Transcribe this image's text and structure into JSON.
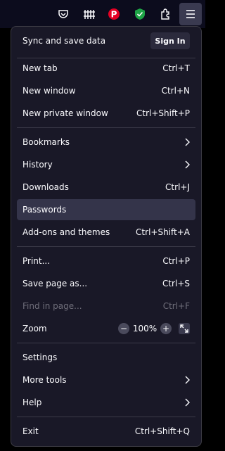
{
  "toolbar": {
    "icons": [
      "pocket-icon",
      "library-icon",
      "pinterest-icon",
      "shield-extension-icon",
      "extensions-icon",
      "menu-icon"
    ],
    "colors": {
      "pinterest": "#e60023",
      "shield": "#1ea446",
      "active_bg": "#3a3a50"
    }
  },
  "sync": {
    "title": "Sync and save data",
    "signin_label": "Sign In"
  },
  "group1": [
    {
      "label": "New tab",
      "shortcut": "Ctrl+T"
    },
    {
      "label": "New window",
      "shortcut": "Ctrl+N"
    },
    {
      "label": "New private window",
      "shortcut": "Ctrl+Shift+P"
    }
  ],
  "group2": [
    {
      "label": "Bookmarks",
      "submenu": true
    },
    {
      "label": "History",
      "submenu": true
    },
    {
      "label": "Downloads",
      "shortcut": "Ctrl+J"
    },
    {
      "label": "Passwords",
      "highlighted": true
    },
    {
      "label": "Add-ons and themes",
      "shortcut": "Ctrl+Shift+A"
    }
  ],
  "group3": [
    {
      "label": "Print...",
      "shortcut": "Ctrl+P"
    },
    {
      "label": "Save page as...",
      "shortcut": "Ctrl+S"
    },
    {
      "label": "Find in page...",
      "shortcut": "Ctrl+F",
      "disabled": true
    }
  ],
  "zoom": {
    "label": "Zoom",
    "value": "100%",
    "minus": "−",
    "plus": "+"
  },
  "group4": [
    {
      "label": "Settings"
    },
    {
      "label": "More tools",
      "submenu": true
    },
    {
      "label": "Help",
      "submenu": true
    }
  ],
  "exit": {
    "label": "Exit",
    "shortcut": "Ctrl+Shift+Q"
  }
}
